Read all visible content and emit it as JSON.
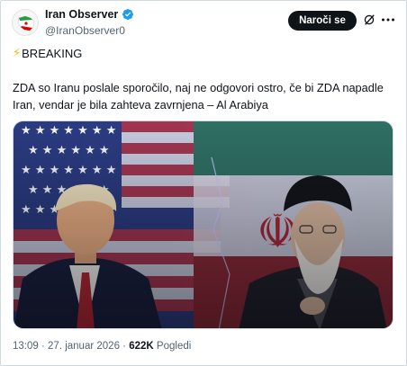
{
  "author": {
    "display_name": "Iran Observer",
    "handle": "@IranObserver0",
    "verified_color": "#1d9bf0"
  },
  "actions": {
    "follow_label": "Naroči se",
    "grok_icon": "grok-icon",
    "more_icon": "more-icon"
  },
  "post": {
    "breaking_label": "BREAKING",
    "breaking_icon": "⚡",
    "text": "ZDA so Iranu poslale sporočilo, naj ne odgovori ostro, če bi ZDA napadle Iran, vendar je bila zahteva zavrnjena – Al Arabiya"
  },
  "meta": {
    "time": "13:09",
    "separator": "·",
    "date": "27. januar 2026",
    "views_count": "622K",
    "views_label": "Pogledi"
  },
  "colors": {
    "text_primary": "#0f1419",
    "text_secondary": "#536471",
    "accent": "#1d9bf0",
    "button_bg": "#0f1419"
  }
}
